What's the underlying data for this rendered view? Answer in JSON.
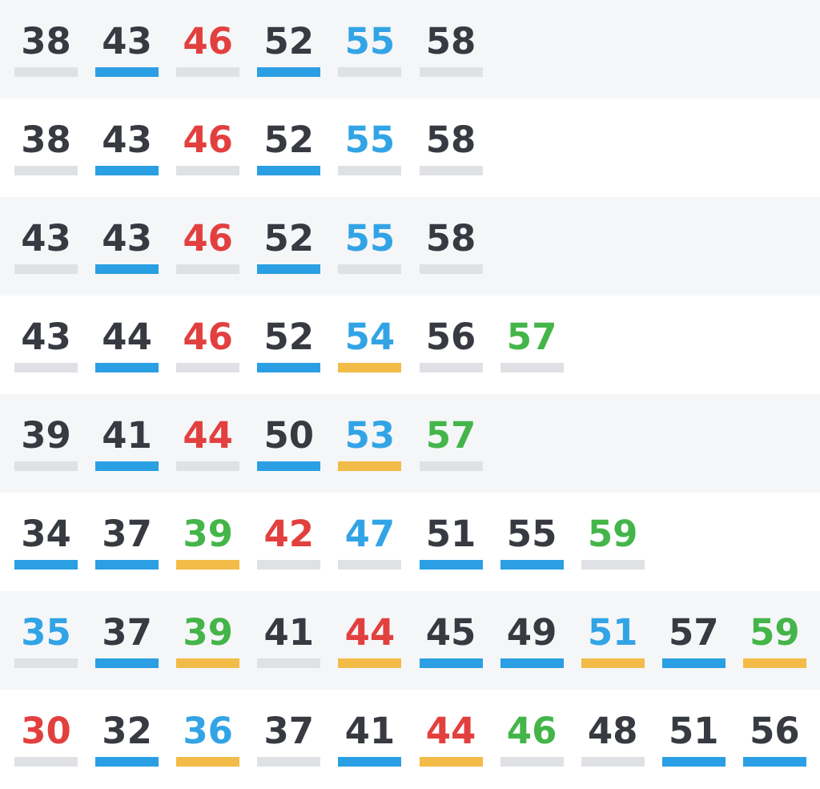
{
  "colors": {
    "text": {
      "dark": "#383a42",
      "red": "#e2403f",
      "blue": "#32a4e6",
      "green": "#44b549"
    },
    "bar": {
      "gray": "#e0e1e4",
      "blue": "#2b9fe3",
      "yellow": "#f3bb48"
    }
  },
  "rows": [
    {
      "shade": "alt",
      "cells": [
        {
          "n": "38",
          "t": "dark",
          "b": "gray"
        },
        {
          "n": "43",
          "t": "dark",
          "b": "blue"
        },
        {
          "n": "46",
          "t": "red",
          "b": "gray"
        },
        {
          "n": "52",
          "t": "dark",
          "b": "blue"
        },
        {
          "n": "55",
          "t": "blue",
          "b": "gray"
        },
        {
          "n": "58",
          "t": "dark",
          "b": "gray"
        }
      ]
    },
    {
      "shade": "plain",
      "cells": [
        {
          "n": "38",
          "t": "dark",
          "b": "gray"
        },
        {
          "n": "43",
          "t": "dark",
          "b": "blue"
        },
        {
          "n": "46",
          "t": "red",
          "b": "gray"
        },
        {
          "n": "52",
          "t": "dark",
          "b": "blue"
        },
        {
          "n": "55",
          "t": "blue",
          "b": "gray"
        },
        {
          "n": "58",
          "t": "dark",
          "b": "gray"
        }
      ]
    },
    {
      "shade": "alt",
      "cells": [
        {
          "n": "43",
          "t": "dark",
          "b": "gray"
        },
        {
          "n": "43",
          "t": "dark",
          "b": "blue"
        },
        {
          "n": "46",
          "t": "red",
          "b": "gray"
        },
        {
          "n": "52",
          "t": "dark",
          "b": "blue"
        },
        {
          "n": "55",
          "t": "blue",
          "b": "gray"
        },
        {
          "n": "58",
          "t": "dark",
          "b": "gray"
        }
      ]
    },
    {
      "shade": "plain",
      "cells": [
        {
          "n": "43",
          "t": "dark",
          "b": "gray"
        },
        {
          "n": "44",
          "t": "dark",
          "b": "blue"
        },
        {
          "n": "46",
          "t": "red",
          "b": "gray"
        },
        {
          "n": "52",
          "t": "dark",
          "b": "blue"
        },
        {
          "n": "54",
          "t": "blue",
          "b": "yellow"
        },
        {
          "n": "56",
          "t": "dark",
          "b": "gray"
        },
        {
          "n": "57",
          "t": "green",
          "b": "gray"
        }
      ]
    },
    {
      "shade": "alt",
      "cells": [
        {
          "n": "39",
          "t": "dark",
          "b": "gray"
        },
        {
          "n": "41",
          "t": "dark",
          "b": "blue"
        },
        {
          "n": "44",
          "t": "red",
          "b": "gray"
        },
        {
          "n": "50",
          "t": "dark",
          "b": "blue"
        },
        {
          "n": "53",
          "t": "blue",
          "b": "yellow"
        },
        {
          "n": "57",
          "t": "green",
          "b": "gray"
        }
      ]
    },
    {
      "shade": "plain",
      "cells": [
        {
          "n": "34",
          "t": "dark",
          "b": "blue"
        },
        {
          "n": "37",
          "t": "dark",
          "b": "blue"
        },
        {
          "n": "39",
          "t": "green",
          "b": "yellow"
        },
        {
          "n": "42",
          "t": "red",
          "b": "gray"
        },
        {
          "n": "47",
          "t": "blue",
          "b": "gray"
        },
        {
          "n": "51",
          "t": "dark",
          "b": "blue"
        },
        {
          "n": "55",
          "t": "dark",
          "b": "blue"
        },
        {
          "n": "59",
          "t": "green",
          "b": "gray"
        }
      ]
    },
    {
      "shade": "alt",
      "cells": [
        {
          "n": "35",
          "t": "blue",
          "b": "gray"
        },
        {
          "n": "37",
          "t": "dark",
          "b": "blue"
        },
        {
          "n": "39",
          "t": "green",
          "b": "yellow"
        },
        {
          "n": "41",
          "t": "dark",
          "b": "gray"
        },
        {
          "n": "44",
          "t": "red",
          "b": "yellow"
        },
        {
          "n": "45",
          "t": "dark",
          "b": "blue"
        },
        {
          "n": "49",
          "t": "dark",
          "b": "blue"
        },
        {
          "n": "51",
          "t": "blue",
          "b": "yellow"
        },
        {
          "n": "57",
          "t": "dark",
          "b": "blue"
        },
        {
          "n": "59",
          "t": "green",
          "b": "yellow"
        }
      ]
    },
    {
      "shade": "plain",
      "cells": [
        {
          "n": "30",
          "t": "red",
          "b": "gray"
        },
        {
          "n": "32",
          "t": "dark",
          "b": "blue"
        },
        {
          "n": "36",
          "t": "blue",
          "b": "yellow"
        },
        {
          "n": "37",
          "t": "dark",
          "b": "gray"
        },
        {
          "n": "41",
          "t": "dark",
          "b": "blue"
        },
        {
          "n": "44",
          "t": "red",
          "b": "yellow"
        },
        {
          "n": "46",
          "t": "green",
          "b": "gray"
        },
        {
          "n": "48",
          "t": "dark",
          "b": "gray"
        },
        {
          "n": "51",
          "t": "dark",
          "b": "blue"
        },
        {
          "n": "56",
          "t": "dark",
          "b": "blue"
        }
      ]
    }
  ]
}
